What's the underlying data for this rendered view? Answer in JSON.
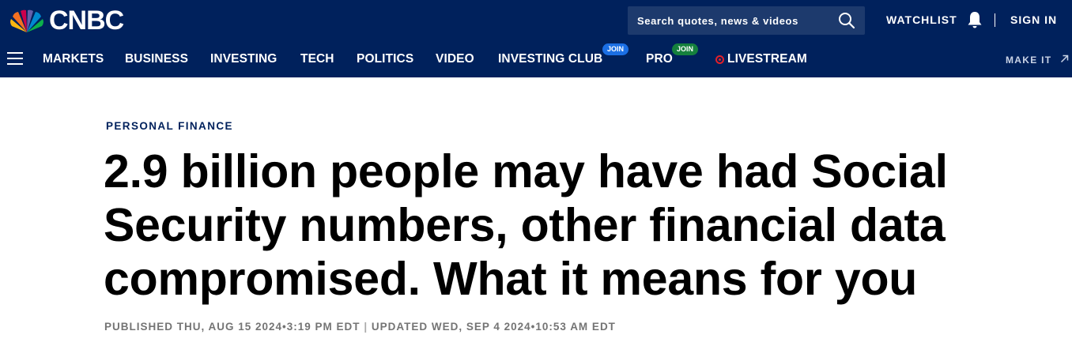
{
  "header": {
    "logo_text": "CNBC",
    "search_placeholder": "Search quotes, news & videos",
    "watchlist_label": "WATCHLIST",
    "signin_label": "SIGN IN"
  },
  "nav": {
    "items": [
      {
        "label": "MARKETS"
      },
      {
        "label": "BUSINESS"
      },
      {
        "label": "INVESTING"
      },
      {
        "label": "TECH"
      },
      {
        "label": "POLITICS"
      },
      {
        "label": "VIDEO"
      },
      {
        "label": "INVESTING CLUB",
        "badge": "JOIN"
      },
      {
        "label": "PRO",
        "badge": "JOIN"
      },
      {
        "label": "LIVESTREAM"
      }
    ],
    "makeit_label": "MAKE IT"
  },
  "article": {
    "category": "PERSONAL FINANCE",
    "headline": "2.9 billion people may have had Social Security numbers, other financial data compromised. What it means for you",
    "published": "PUBLISHED THU, AUG 15 2024•3:19 PM EDT",
    "separator": "|",
    "updated": "UPDATED WED, SEP 4 2024•10:53 AM EDT"
  },
  "colors": {
    "header_bg": "#00215c",
    "search_bg": "#1d3a6d",
    "badge_blue": "#1b6fe4",
    "badge_green": "#15803d",
    "live_red": "#e2202a"
  }
}
